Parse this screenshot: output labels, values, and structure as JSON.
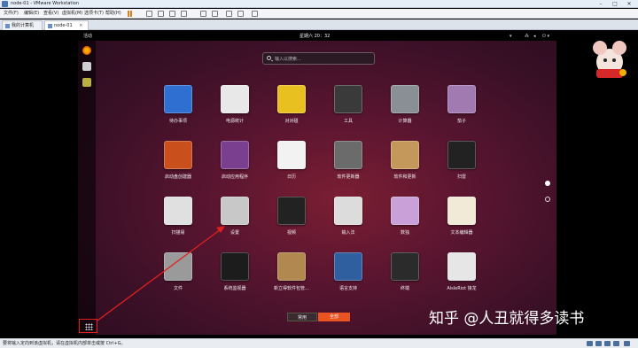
{
  "window": {
    "title": "node-01 - VMware Workstation"
  },
  "menu": [
    "文件(F)",
    "编辑(E)",
    "查看(V)",
    "虚拟机(M)",
    "选项卡(T)",
    "帮助(H)"
  ],
  "tabs": [
    {
      "label": "我的计算机",
      "active": false
    },
    {
      "label": "node-01",
      "active": true
    }
  ],
  "guest": {
    "activities": "活动",
    "clock": "星期六 20：32",
    "search_placeholder": "输入以搜索…",
    "apps": [
      {
        "label": "待办事项",
        "icon": "checkbox-icon",
        "color": "#2f6fd1"
      },
      {
        "label": "电源统计",
        "icon": "power-stats-icon",
        "color": "#e8e8e8"
      },
      {
        "label": "对对碰",
        "icon": "swell-foop-icon",
        "color": "#e8c020"
      },
      {
        "label": "工具",
        "icon": "tools-folder-icon",
        "color": "#3a3a3a"
      },
      {
        "label": "计算器",
        "icon": "calculator-icon",
        "color": "#8a8f95"
      },
      {
        "label": "茄子",
        "icon": "cheese-icon",
        "color": "#a07ab0"
      },
      {
        "label": "启动盘创建器",
        "icon": "startup-disk-icon",
        "color": "#c9501c"
      },
      {
        "label": "启动应用程序",
        "icon": "startup-apps-icon",
        "color": "#7b3f8f"
      },
      {
        "label": "日历",
        "icon": "calendar-icon",
        "color": "#f2f2f2"
      },
      {
        "label": "软件更新器",
        "icon": "software-updater-icon",
        "color": "#6b6b6b"
      },
      {
        "label": "软件和更新",
        "icon": "software-sources-icon",
        "color": "#c4975a"
      },
      {
        "label": "扫雷",
        "icon": "mines-icon",
        "color": "#222222"
      },
      {
        "label": "扫描易",
        "icon": "scanner-icon",
        "color": "#e0e0e0"
      },
      {
        "label": "设置",
        "icon": "settings-icon",
        "color": "#c8c8c8"
      },
      {
        "label": "视频",
        "icon": "video-icon",
        "color": "#222222"
      },
      {
        "label": "输入法",
        "icon": "keyboard-icon",
        "color": "#dcdcdc"
      },
      {
        "label": "数独",
        "icon": "sudoku-icon",
        "color": "#c9a0d8"
      },
      {
        "label": "文本编辑器",
        "icon": "text-editor-icon",
        "color": "#f0ead6"
      },
      {
        "label": "文件",
        "icon": "files-icon",
        "color": "#9a9a9a"
      },
      {
        "label": "系统监视器",
        "icon": "system-monitor-icon",
        "color": "#1c1c1c"
      },
      {
        "label": "新立得软件包管…",
        "icon": "synaptic-icon",
        "color": "#b08850"
      },
      {
        "label": "语言支持",
        "icon": "language-icon",
        "color": "#2f5f9f"
      },
      {
        "label": "终端",
        "icon": "terminal-icon",
        "color": "#2b2b2b"
      },
      {
        "label": "AisleRiot 接龙",
        "icon": "cards-icon",
        "color": "#e6e6e6"
      }
    ],
    "seg_frequent": "常用",
    "seg_all": "全部"
  },
  "status": "要将输入定向到该虚拟机，请在虚拟机内部单击或按 Ctrl+G。",
  "watermark": "知乎 @人丑就得多读书",
  "colors": {
    "accent": "#e95420",
    "annotation": "#e02020"
  }
}
